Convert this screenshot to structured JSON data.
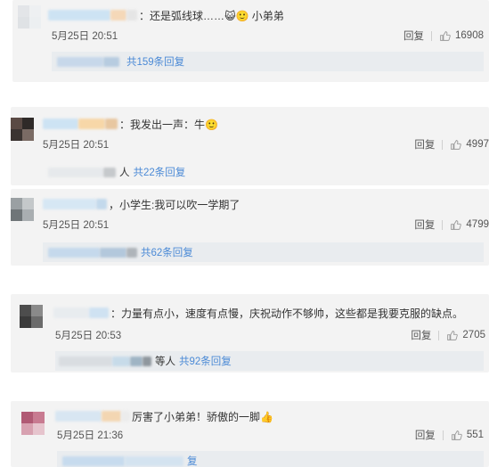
{
  "comments": [
    {
      "text": "：还是弧线球……😺🙂 小弟弟",
      "time": "5月25日 20:51",
      "reply_label": "回复",
      "likes": "16908",
      "replies": "共159条回复",
      "reply_prefix": ""
    },
    {
      "text": "：我发出一声：牛🙂",
      "time": "5月25日 20:51",
      "reply_label": "回复",
      "likes": "4997",
      "replies": "共22条回复",
      "reply_prefix": "人"
    },
    {
      "text": "，小学生:我可以吹一学期了",
      "time": "5月25日 20:51",
      "reply_label": "回复",
      "likes": "4799",
      "replies": "共62条回复",
      "reply_prefix": ""
    },
    {
      "text": "：力量有点小，速度有点慢，庆祝动作不够帅，这些都是我要克服的缺点。",
      "time": "5月25日 20:53",
      "reply_label": "回复",
      "likes": "2705",
      "replies": "共92条回复",
      "reply_prefix": "等人"
    },
    {
      "text": "厉害了小弟弟！骄傲的一脚👍",
      "time": "5月25日 21:36",
      "reply_label": "回复",
      "likes": "551",
      "replies": "复",
      "reply_prefix": ""
    }
  ],
  "colors": {
    "link": "#4b8ad6",
    "card_bg": "#f3f3f3",
    "reply_bg": "#e9ecef"
  },
  "icons": [
    "thumbs-up-icon",
    "emoji-face-icon"
  ]
}
